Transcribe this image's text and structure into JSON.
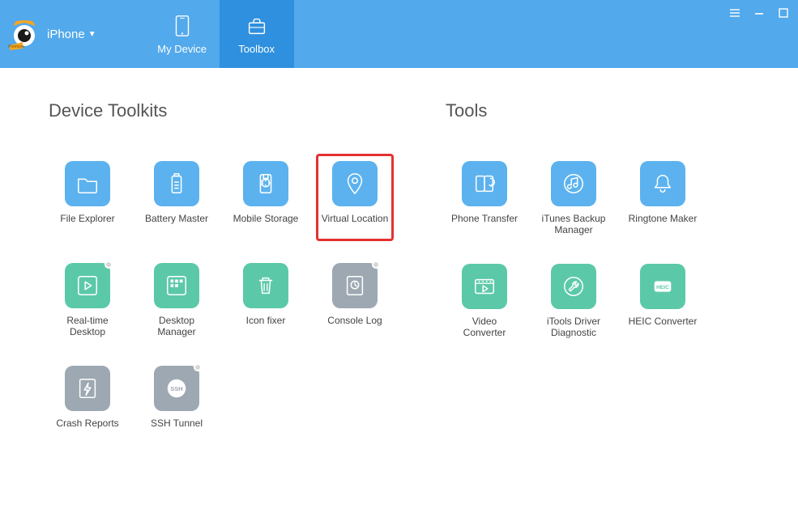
{
  "header": {
    "device_label": "iPhone",
    "premium_badge": "Premium",
    "nav": {
      "my_device": "My Device",
      "toolbox": "Toolbox"
    }
  },
  "sections": {
    "device_toolkits_title": "Device Toolkits",
    "tools_title": "Tools"
  },
  "device_toolkits": [
    {
      "id": "file-explorer",
      "label": "File Explorer",
      "color": "blue",
      "icon": "folder",
      "highlight": false
    },
    {
      "id": "battery-master",
      "label": "Battery Master",
      "color": "blue",
      "icon": "battery",
      "highlight": false
    },
    {
      "id": "mobile-storage",
      "label": "Mobile Storage",
      "color": "blue",
      "icon": "usb",
      "highlight": false
    },
    {
      "id": "virtual-location",
      "label": "Virtual Location",
      "color": "blue",
      "icon": "location",
      "highlight": true
    },
    {
      "id": "realtime-desktop",
      "label": "Real-time Desktop",
      "color": "green",
      "icon": "play",
      "highlight": false,
      "dot": true
    },
    {
      "id": "desktop-manager",
      "label": "Desktop Manager",
      "color": "green",
      "icon": "apps",
      "highlight": false
    },
    {
      "id": "icon-fixer",
      "label": "Icon fixer",
      "color": "green",
      "icon": "trash",
      "highlight": false
    },
    {
      "id": "console-log",
      "label": "Console Log",
      "color": "grey",
      "icon": "log",
      "highlight": false,
      "dot": true
    },
    {
      "id": "crash-reports",
      "label": "Crash Reports",
      "color": "grey",
      "icon": "crash",
      "highlight": false
    },
    {
      "id": "ssh-tunnel",
      "label": "SSH Tunnel",
      "color": "grey",
      "icon": "ssh",
      "highlight": false,
      "dot": true
    }
  ],
  "tools": [
    {
      "id": "phone-transfer",
      "label": "Phone Transfer",
      "color": "blue",
      "icon": "transfer"
    },
    {
      "id": "itunes-backup",
      "label": "iTunes Backup Manager",
      "color": "blue",
      "icon": "itunes"
    },
    {
      "id": "ringtone-maker",
      "label": "Ringtone Maker",
      "color": "blue",
      "icon": "bell"
    },
    {
      "id": "video-converter",
      "label": "Video Converter",
      "color": "green",
      "icon": "video"
    },
    {
      "id": "driver-diag",
      "label": "iTools Driver Diagnostic",
      "color": "green",
      "icon": "wrench"
    },
    {
      "id": "heic-converter",
      "label": "HEIC Converter",
      "color": "green",
      "icon": "heic"
    }
  ]
}
